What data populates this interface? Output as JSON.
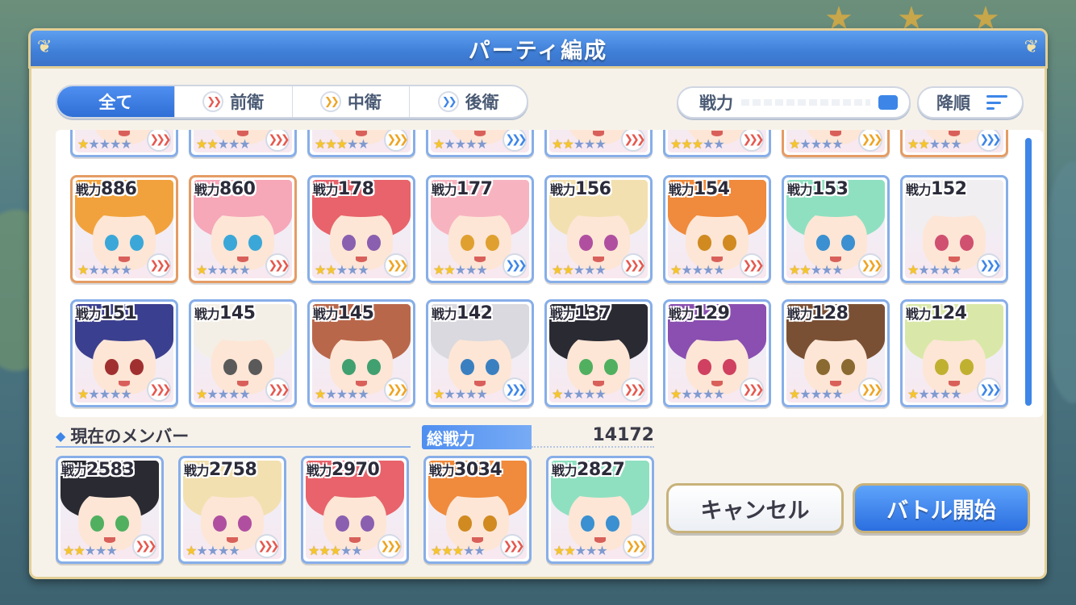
{
  "title": "パーティ編成",
  "tabs": [
    {
      "label": "全て",
      "icon": "",
      "active": true
    },
    {
      "label": "前衛",
      "icon": "chevron-red-icon",
      "active": false
    },
    {
      "label": "中衛",
      "icon": "chevron-yellow-icon",
      "active": false
    },
    {
      "label": "後衛",
      "icon": "chevron-blue-icon",
      "active": false
    }
  ],
  "sort": {
    "label": "戦力",
    "order_label": "降順"
  },
  "power_prefix": "戦力",
  "roster_row2": [
    {
      "power": "886",
      "stars": 1
    },
    {
      "power": "860",
      "stars": 1
    },
    {
      "power": "178",
      "stars": 2
    },
    {
      "power": "177",
      "stars": 2
    },
    {
      "power": "156",
      "stars": 2
    },
    {
      "power": "154",
      "stars": 1
    },
    {
      "power": "153",
      "stars": 2
    },
    {
      "power": "152",
      "stars": 1
    }
  ],
  "roster_row3": [
    {
      "power": "151",
      "stars": 1
    },
    {
      "power": "145",
      "stars": 1
    },
    {
      "power": "145",
      "stars": 1
    },
    {
      "power": "142",
      "stars": 1
    },
    {
      "power": "137",
      "stars": 1
    },
    {
      "power": "129",
      "stars": 1
    },
    {
      "power": "128",
      "stars": 1
    },
    {
      "power": "124",
      "stars": 1
    }
  ],
  "members_heading": "現在のメンバー",
  "total_power_label": "総戦力",
  "total_power_value": "14172",
  "members": [
    {
      "power": "2583",
      "stars": 2
    },
    {
      "power": "2758",
      "stars": 1
    },
    {
      "power": "2970",
      "stars": 3
    },
    {
      "power": "3034",
      "stars": 3
    },
    {
      "power": "2827",
      "stars": 2
    }
  ],
  "buttons": {
    "cancel": "キャンセル",
    "start": "バトル開始"
  },
  "colors": {
    "accent_blue": "#3d86e8",
    "title_bar": "#4a8be4",
    "frame_gold": "#e4cf96"
  }
}
